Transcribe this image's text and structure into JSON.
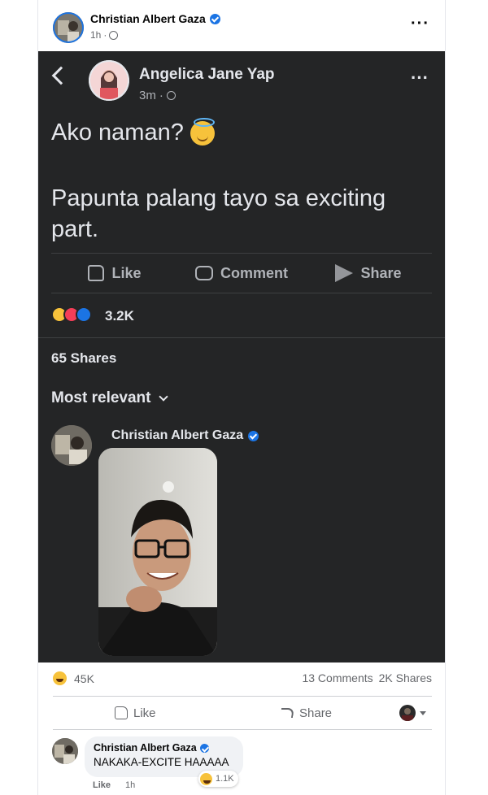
{
  "post": {
    "author": "Christian Albert Gaza",
    "time": "1h",
    "more_icon": "more-dots-icon"
  },
  "shared_screenshot": {
    "author": "Angelica Jane Yap",
    "time": "3m",
    "line1": "Ako naman?",
    "line2": "Papunta palang tayo sa exciting part.",
    "actions": {
      "like": "Like",
      "comment": "Comment",
      "share": "Share"
    },
    "reaction_count": "3.2K",
    "shares": "65 Shares",
    "sort": "Most relevant",
    "comment_author": "Christian Albert Gaza"
  },
  "stats": {
    "reactions": "45K",
    "comments": "13 Comments",
    "shares": "2K Shares"
  },
  "bar": {
    "like": "Like",
    "share": "Share"
  },
  "comment": {
    "author": "Christian Albert Gaza",
    "text": "NAKAKA-EXCITE HAAAAA",
    "reactions": "1.1K",
    "like": "Like",
    "time": "1h"
  },
  "colors": {
    "accent": "#1b74e4",
    "dark_bg": "#242526",
    "haha": "#f7c23b",
    "love": "#f33e58"
  }
}
